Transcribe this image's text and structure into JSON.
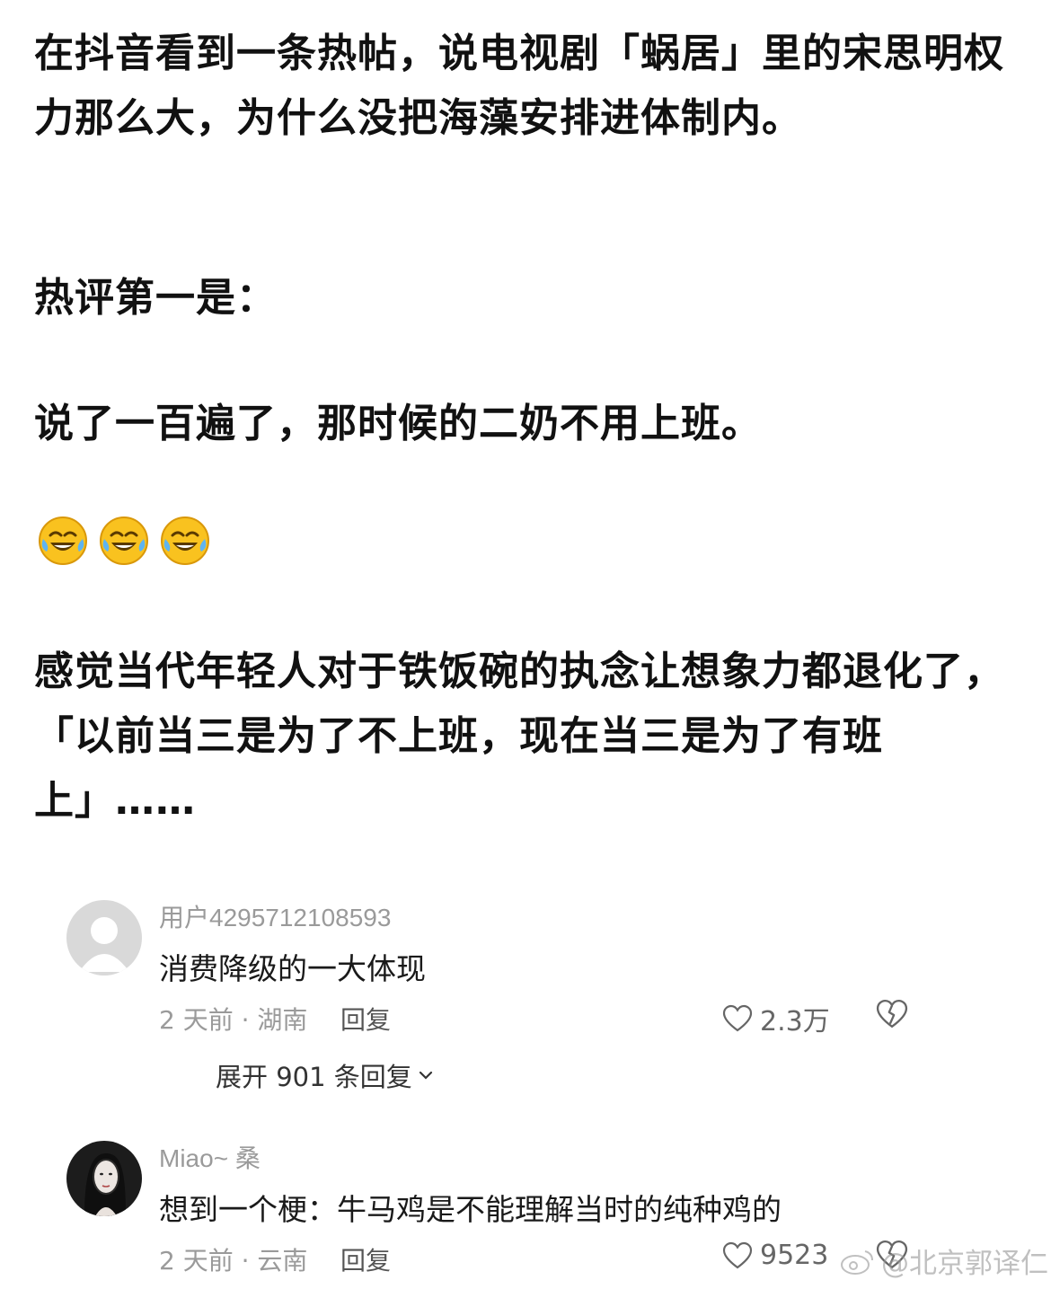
{
  "post": {
    "paragraph1": "在抖音看到一条热帖，说电视剧「蜗居」里的宋思明权力那么大，为什么没把海藻安排进体制内。",
    "paragraph2": "热评第一是：",
    "paragraph3": "说了一百遍了，那时候的二奶不用上班。",
    "emojis": [
      "laughing-tears-emoji",
      "laughing-tears-emoji",
      "laughing-tears-emoji"
    ],
    "paragraph4": "感觉当代年轻人对于铁饭碗的执念让想象力都退化了，「以前当三是为了不上班，现在当三是为了有班上」……"
  },
  "comments": [
    {
      "username": "用户4295712108593",
      "text": "消费降级的一大体现",
      "meta": "2 天前 · 湖南",
      "reply_label": "回复",
      "likes": "2.3万",
      "expand_label": "展开 901 条回复"
    },
    {
      "username": "Miao~ 桑",
      "text": "想到一个梗：牛马鸡是不能理解当时的纯种鸡的",
      "meta": "2 天前 · 云南",
      "reply_label": "回复",
      "likes": "9523"
    }
  ],
  "watermark": "@北京郭译仁"
}
